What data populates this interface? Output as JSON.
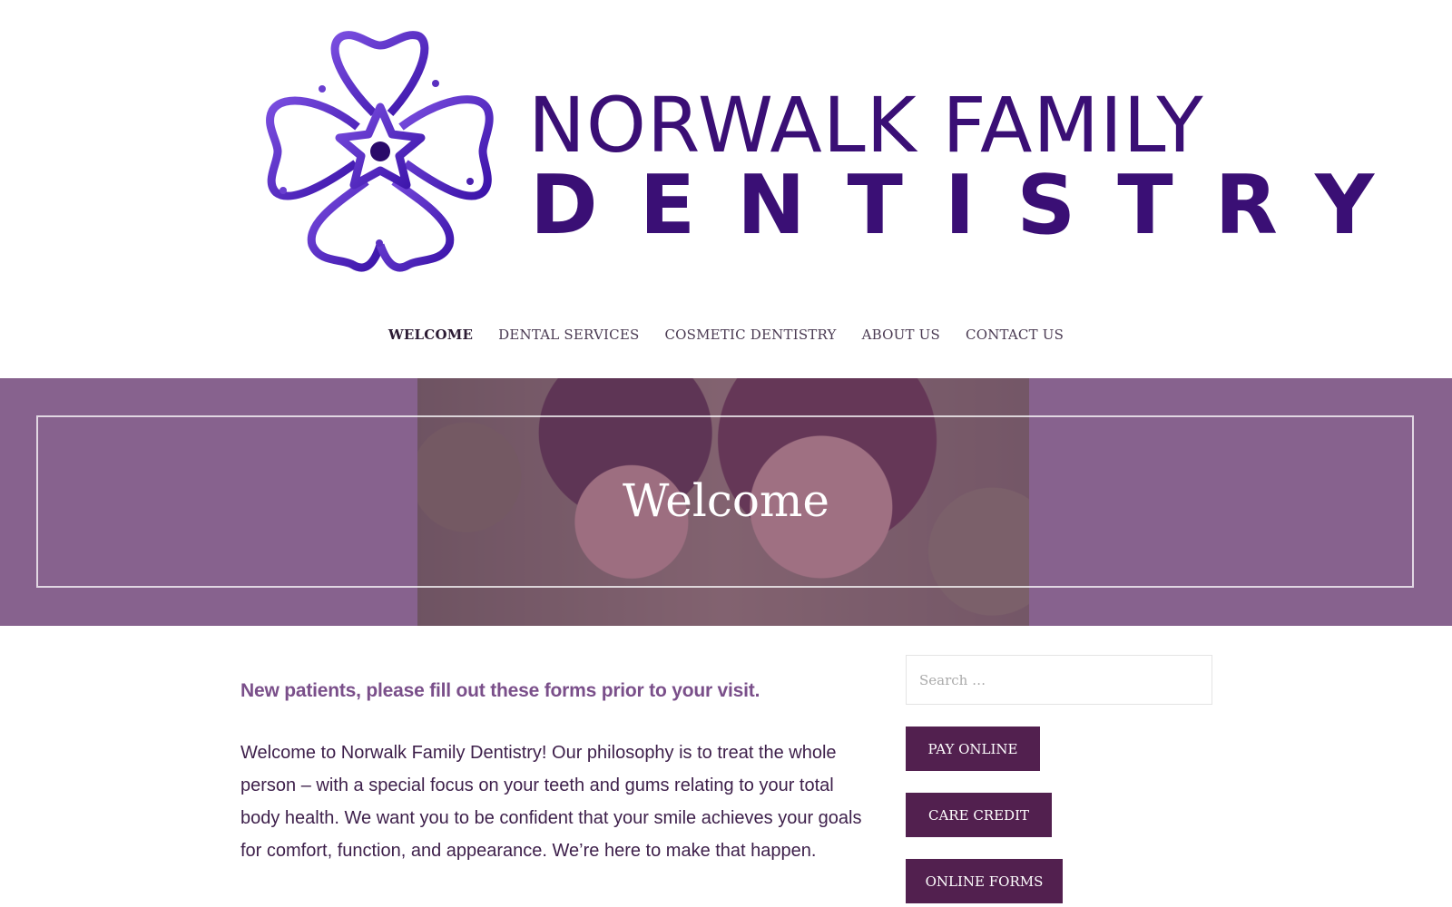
{
  "logo": {
    "line1": "NORWALK FAMILY",
    "line2": "DENTISTRY",
    "icon": "flower-tooth-logo",
    "colors": {
      "primary": "#3a0f75",
      "accent": "#6a3fd0"
    }
  },
  "nav": {
    "items": [
      {
        "label": "WELCOME",
        "active": true
      },
      {
        "label": "DENTAL SERVICES"
      },
      {
        "label": "COSMETIC DENTISTRY"
      },
      {
        "label": "ABOUT US"
      },
      {
        "label": "CONTACT US"
      }
    ]
  },
  "hero": {
    "title": "Welcome",
    "overlay_color": "#a58ea9"
  },
  "main": {
    "forms_link": "New patients, please fill out these forms prior to your visit.",
    "intro": "Welcome to Norwalk Family Dentistry! Our philosophy is to treat the whole person – with a special focus on your teeth and gums relating to your total body health. We want you to be confident that your smile achieves your goals for comfort, function, and appearance. We’re here to make that happen."
  },
  "sidebar": {
    "search_placeholder": "Search …",
    "buttons": {
      "pay_online": "PAY ONLINE",
      "care_credit": "CARE CREDIT",
      "online_forms": "ONLINE FORMS"
    },
    "button_color": "#52204f"
  }
}
